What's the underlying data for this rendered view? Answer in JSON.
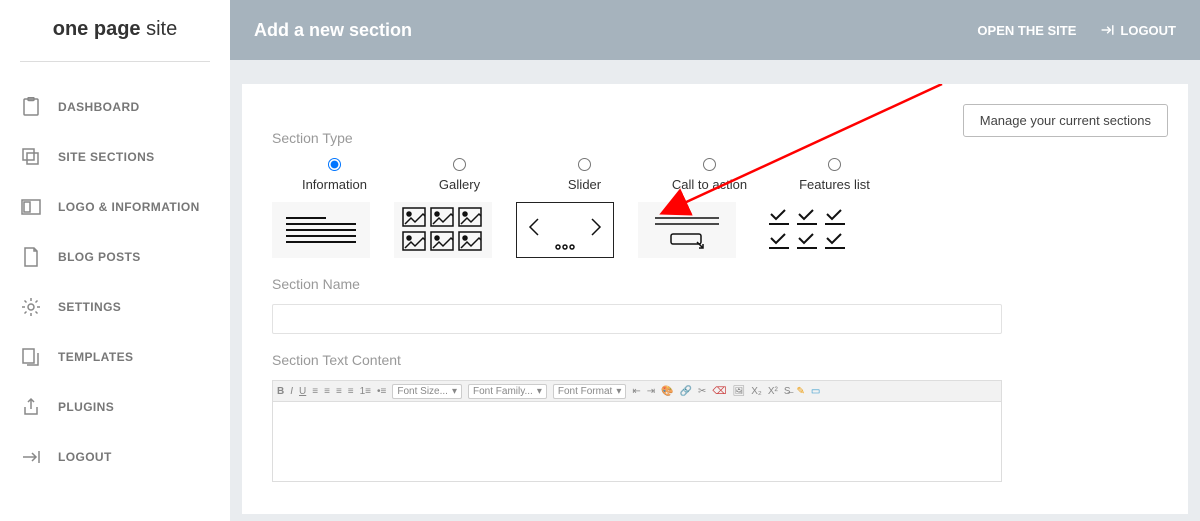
{
  "logo": {
    "bold": "one page",
    "light": " site"
  },
  "nav": [
    {
      "label": "DASHBOARD"
    },
    {
      "label": "SITE SECTIONS"
    },
    {
      "label": "LOGO & INFORMATION"
    },
    {
      "label": "BLOG POSTS"
    },
    {
      "label": "SETTINGS"
    },
    {
      "label": "TEMPLATES"
    },
    {
      "label": "PLUGINS"
    },
    {
      "label": "LOGOUT"
    }
  ],
  "topbar": {
    "title": "Add a new section",
    "open_site": "OPEN THE SITE",
    "logout": "LOGOUT"
  },
  "card": {
    "manage_btn": "Manage your current sections",
    "section_type_label": "Section Type",
    "types": [
      {
        "name": "Information"
      },
      {
        "name": "Gallery"
      },
      {
        "name": "Slider"
      },
      {
        "name": "Call to action"
      },
      {
        "name": "Features list"
      }
    ],
    "slider_dots": "○ ○ ○",
    "section_name_label": "Section Name",
    "section_name_value": "",
    "section_text_label": "Section Text Content",
    "toolbar": {
      "font_size": "Font Size...",
      "font_family": "Font Family...",
      "font_format": "Font Format"
    }
  }
}
